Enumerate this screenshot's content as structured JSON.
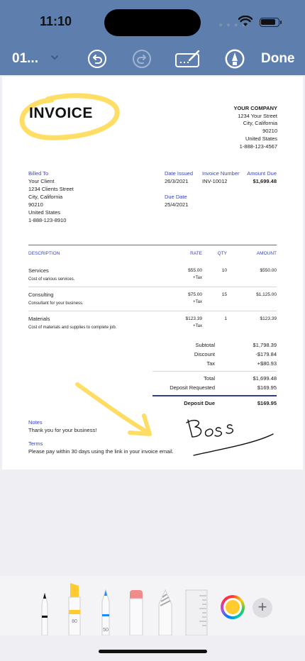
{
  "status": {
    "time": "11:10"
  },
  "toolbar": {
    "title": "01...",
    "done": "Done",
    "icons": [
      "undo-icon",
      "redo-icon",
      "signature-icon",
      "markup-pen-icon"
    ]
  },
  "invoice": {
    "title": "INVOICE",
    "company": [
      "YOUR COMPANY",
      "1234 Your Street",
      "City, California",
      "90210",
      "United States",
      "1-888-123-4567"
    ],
    "billed_to_label": "Billed To",
    "billed_to": [
      "Your Client",
      "1234 Clients Street",
      "City, California",
      "90210",
      "United States",
      "1-888-123-8910"
    ],
    "date_issued_label": "Date Issued",
    "date_issued": "26/3/2021",
    "due_date_label": "Due Date",
    "due_date": "25/4/2021",
    "invoice_number_label": "Invoice Number",
    "invoice_number": "INV-10012",
    "amount_due_label": "Amount Due",
    "amount_due": "$1,699.48",
    "columns": {
      "description": "DESCRIPTION",
      "rate": "RATE",
      "qty": "QTY",
      "amount": "AMOUNT"
    },
    "items": [
      {
        "name": "Services",
        "desc": "Cost of various services.",
        "rate": "$55.00",
        "tax": "+Tax",
        "qty": "10",
        "amount": "$550.00"
      },
      {
        "name": "Consulting",
        "desc": "Consultant for your business.",
        "rate": "$75.00",
        "tax": "+Tax",
        "qty": "15",
        "amount": "$1,125.00"
      },
      {
        "name": "Materials",
        "desc": "Cost of materials and supplies to complete job.",
        "rate": "$123.39",
        "tax": "+Tax",
        "qty": "1",
        "amount": "$123.39"
      }
    ],
    "totals": {
      "subtotal_label": "Subtotal",
      "subtotal": "$1,798.39",
      "discount_label": "Discount",
      "discount": "-$179.84",
      "tax_label": "Tax",
      "tax": "+$80.93",
      "total_label": "Total",
      "total": "$1,699.48",
      "deposit_label": "Deposit Requested",
      "deposit": "$169.95",
      "deposit_due_label": "Deposit Due",
      "deposit_due": "$169.95"
    },
    "notes_label": "Notes",
    "notes": "Thank you for your business!",
    "terms_label": "Terms",
    "terms": "Please pay within 30 days using the link in your invoice email."
  },
  "markup_tools": {
    "highlighter_size": "80",
    "pen_size": "50",
    "selected_color": "#ffcb2e"
  }
}
